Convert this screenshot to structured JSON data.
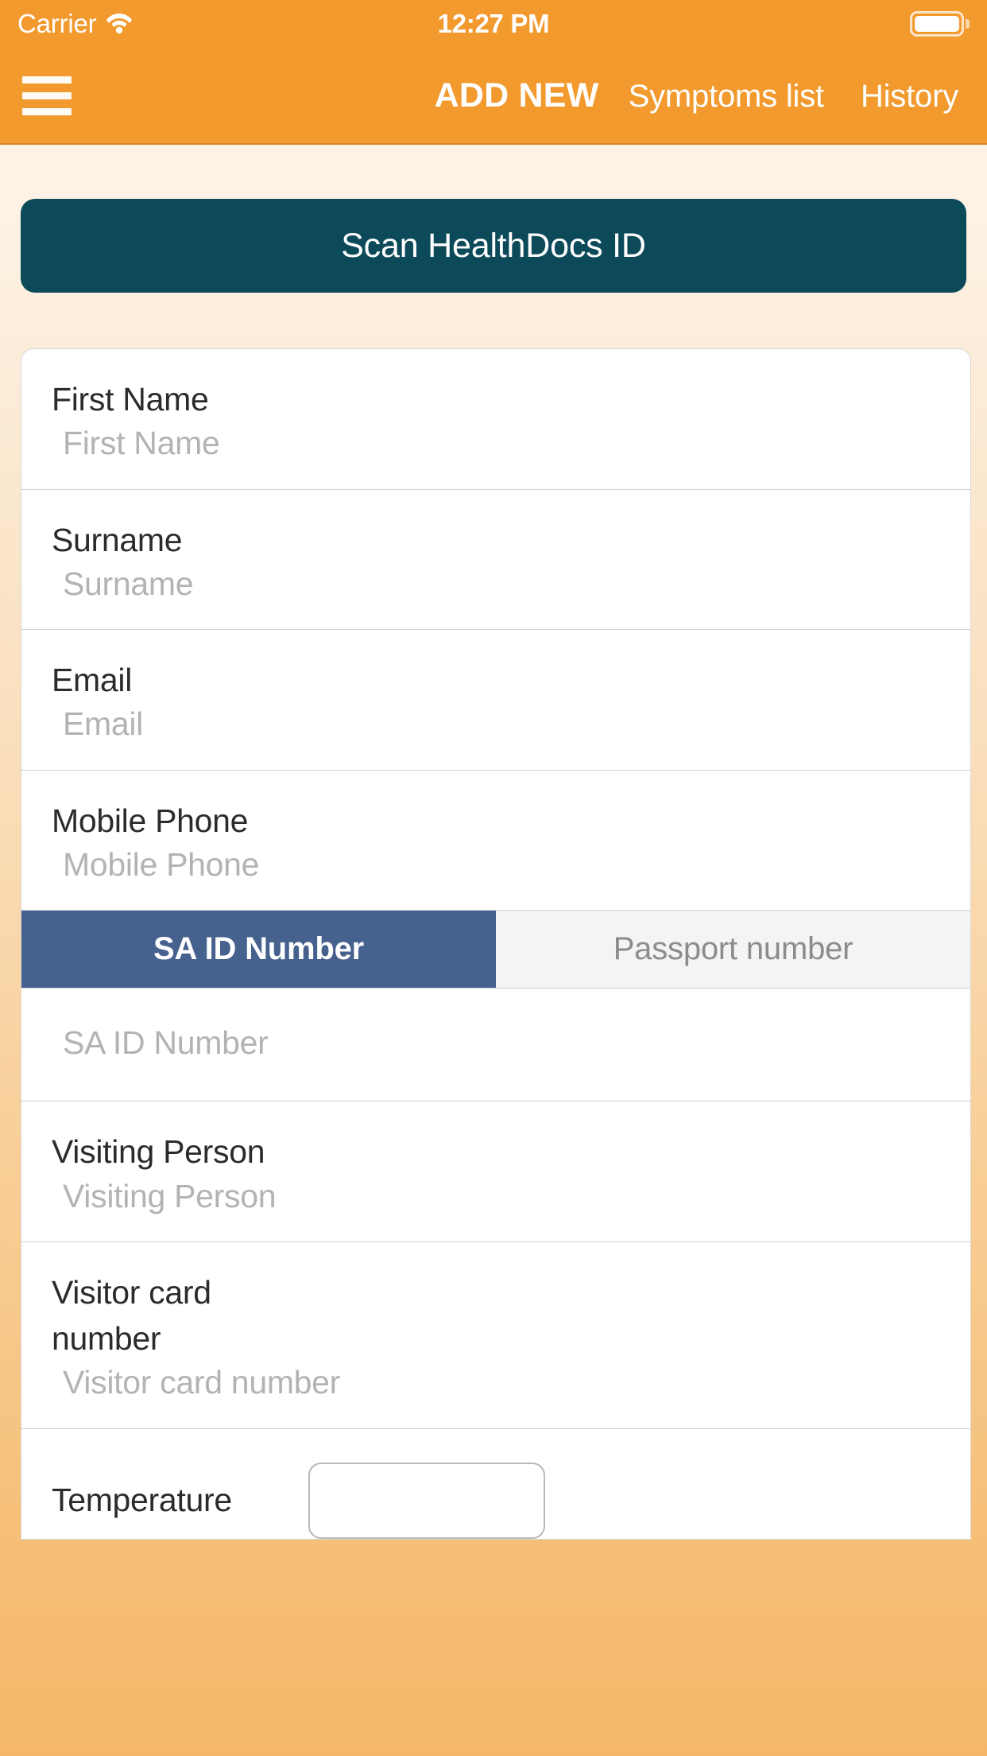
{
  "status_bar": {
    "carrier": "Carrier",
    "time": "12:27 PM",
    "wifi_icon": "wifi-icon",
    "battery_icon": "battery-full-icon"
  },
  "nav": {
    "menu_icon": "hamburger-menu-icon",
    "title": "ADD NEW",
    "links": [
      {
        "label": "Symptoms list"
      },
      {
        "label": "History"
      }
    ]
  },
  "scan": {
    "label": "Scan HealthDocs ID"
  },
  "form": {
    "fields": [
      {
        "label": "First Name",
        "placeholder": "First Name"
      },
      {
        "label": "Surname",
        "placeholder": "Surname"
      },
      {
        "label": "Email",
        "placeholder": "Email"
      },
      {
        "label": "Mobile Phone",
        "placeholder": "Mobile Phone"
      }
    ],
    "id_segments": [
      {
        "label": "SA ID Number",
        "active": true
      },
      {
        "label": "Passport number",
        "active": false
      }
    ],
    "id_placeholder": "SA ID Number",
    "fields_after": [
      {
        "label": "Visiting Person",
        "placeholder": "Visiting Person"
      },
      {
        "label": "Visitor card number",
        "placeholder": "Visitor card number"
      }
    ],
    "temperature": {
      "label": "Temperature",
      "value": ""
    }
  },
  "colors": {
    "accent_orange": "#f29a2e",
    "scan_button": "#0c4a5a",
    "segment_active": "#46618e",
    "label_text": "#2b2b2b",
    "placeholder_text": "#b3b3b3"
  }
}
